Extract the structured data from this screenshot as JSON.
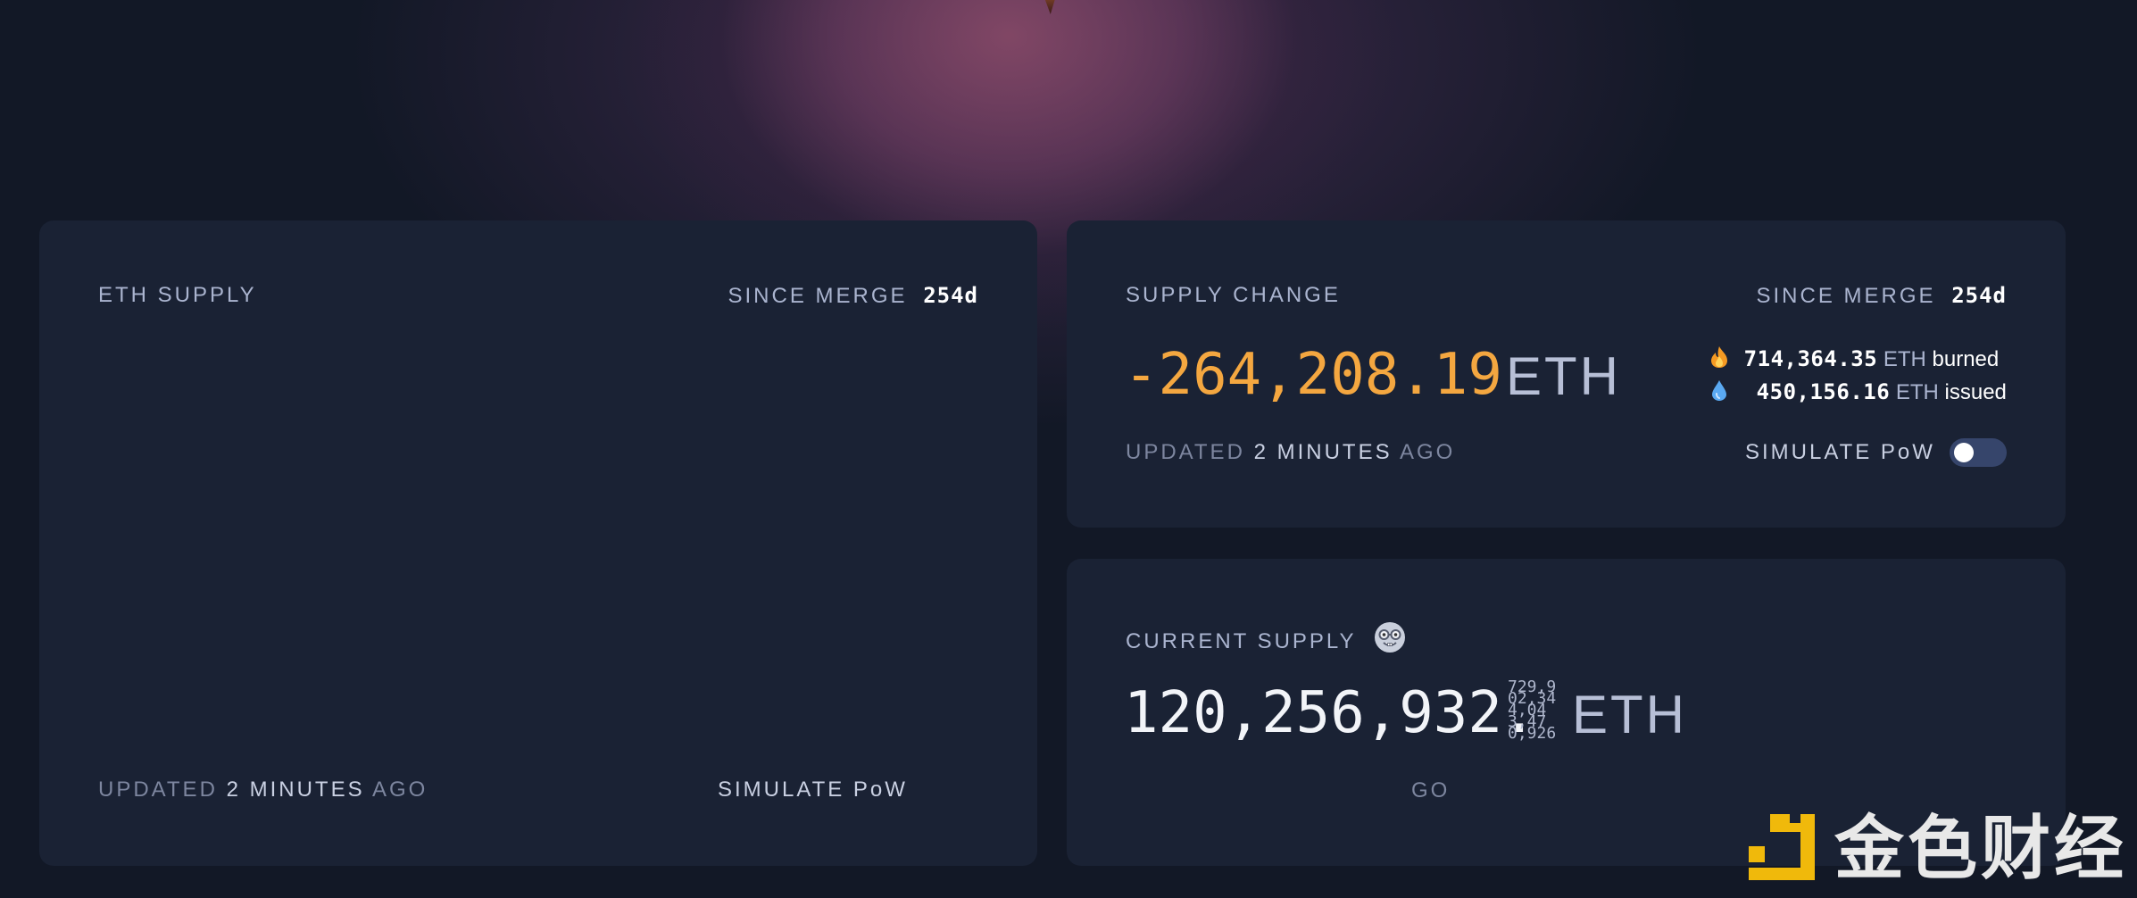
{
  "eth_supply_card": {
    "title": "ETH SUPPLY",
    "since_label": "SINCE MERGE",
    "since_value": "254d",
    "updated_prefix": "UPDATED",
    "updated_num": "2",
    "updated_unit": "MINUTES",
    "updated_suffix": "AGO",
    "simulate_label": "SIMULATE PoW"
  },
  "supply_change_card": {
    "title": "SUPPLY CHANGE",
    "since_label": "SINCE MERGE",
    "since_value": "254d",
    "change_value": "-264,208.19",
    "change_unit": "ETH",
    "burned_value": "714,364.35",
    "burned_unit": "ETH",
    "burned_label": "burned",
    "issued_value": "450,156.16",
    "issued_unit": "ETH",
    "issued_label": "issued",
    "updated_prefix": "UPDATED",
    "updated_num": "2",
    "updated_unit": "MINUTES",
    "updated_suffix": "AGO",
    "simulate_label": "SIMULATE PoW",
    "simulate_enabled": false,
    "accent_color": "#f4a740",
    "icons": {
      "burned": "fire-icon",
      "issued": "droplet-icon"
    }
  },
  "current_supply_card": {
    "title": "CURRENT SUPPLY",
    "title_icon": "nerd-face-icon",
    "integer_part": "120,256,932.",
    "rolling_digits": "729,9\n02,34\n4,04\n3,47\n0,926",
    "unit": "ETH",
    "footer_text": "GO"
  },
  "watermark": {
    "text": "金色财经",
    "logo_icon": "jinse-logo-icon"
  }
}
